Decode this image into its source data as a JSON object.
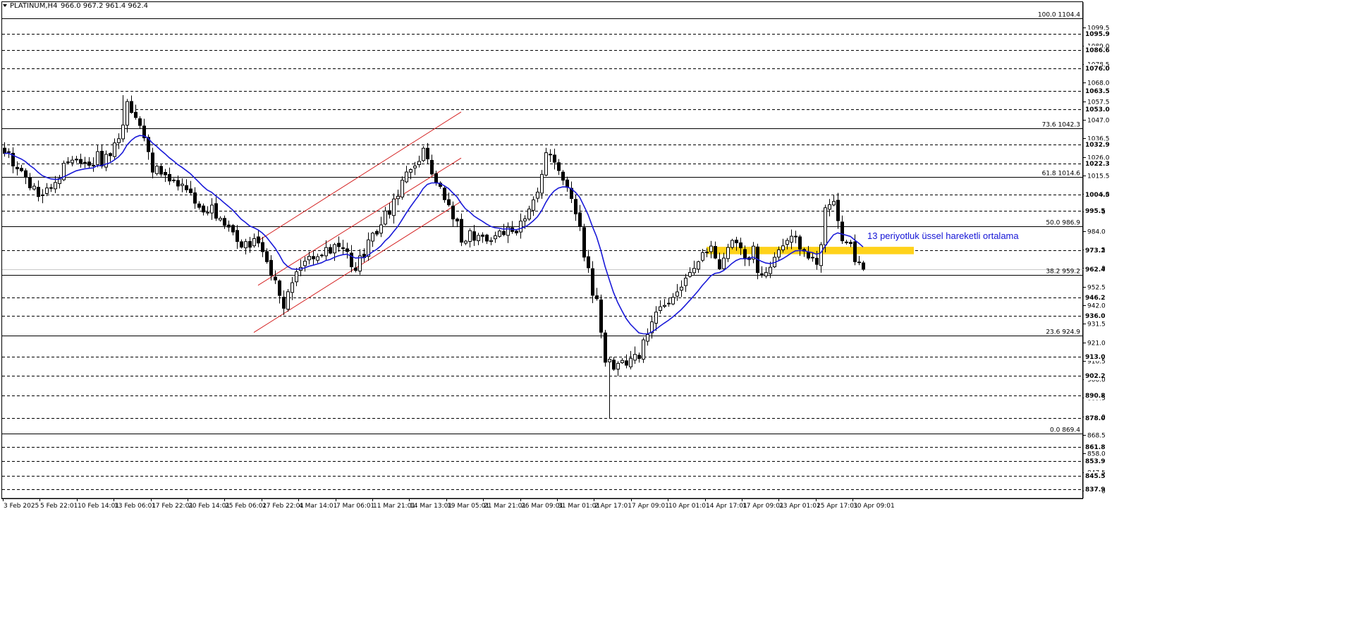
{
  "header": {
    "collapse_icon": "triangle-down-icon",
    "symbol_label": "PLATINUM,H4",
    "ohlc_text": "966.0 967.2 961.4 962.4"
  },
  "annotation": {
    "text": "13 periyotluk üssel hareketli ortalama"
  },
  "colors": {
    "candle": "#000000",
    "ema": "#1a1ad8",
    "channel": "#d42020",
    "zone": "#ffd21a",
    "grid": "#000000",
    "background": "#ffffff"
  },
  "chart_data": {
    "type": "line",
    "symbol": "PLATINUM",
    "timeframe": "H4",
    "ylim": [
      832.6,
      1113.7
    ],
    "y_ticks": [
      1099.5,
      1089.0,
      1078.5,
      1068.0,
      1057.5,
      1047.0,
      1036.5,
      1026.0,
      1015.5,
      1005.0,
      995.0,
      984.0,
      973.5,
      963.0,
      952.5,
      942.0,
      931.5,
      921.0,
      910.5,
      900.0,
      889.5,
      879.0,
      868.5,
      858.0,
      847.5,
      837.0
    ],
    "x_labels": [
      "3 Feb 2025",
      "5 Feb 22:01",
      "10 Feb 14:01",
      "13 Feb 06:01",
      "17 Feb 22:01",
      "20 Feb 14:01",
      "25 Feb 06:01",
      "27 Feb 22:01",
      "4 Mar 14:01",
      "7 Mar 06:01",
      "11 Mar 21:01",
      "14 Mar 13:01",
      "19 Mar 05:01",
      "21 Mar 21:01",
      "26 Mar 09:01",
      "31 Mar 01:01",
      "2 Apr 17:01",
      "7 Apr 09:01",
      "10 Apr 01:01",
      "14 Apr 17:01",
      "17 Apr 09:01",
      "23 Apr 01:01",
      "25 Apr 17:01",
      "30 Apr 09:01"
    ],
    "price_levels": [
      1095.9,
      1086.6,
      1076.0,
      1063.5,
      1053.0,
      1032.9,
      1022.3,
      1004.5,
      995.5,
      973.2,
      946.2,
      936.0,
      913.0,
      902.2,
      890.8,
      878.0,
      861.8,
      853.9,
      845.5,
      837.9
    ],
    "current_price": 962.4,
    "fibonacci": [
      {
        "ratio": "100.0",
        "price": 1104.4
      },
      {
        "ratio": "73.6",
        "price": 1042.3
      },
      {
        "ratio": "61.8",
        "price": 1014.6
      },
      {
        "ratio": "50.0",
        "price": 986.9
      },
      {
        "ratio": "38.2",
        "price": 959.2
      },
      {
        "ratio": "23.6",
        "price": 924.9
      },
      {
        "ratio": "0.0",
        "price": 869.4
      }
    ],
    "close_path": [
      [
        0,
        1028
      ],
      [
        3,
        1020
      ],
      [
        6,
        1010
      ],
      [
        9,
        1003
      ],
      [
        11,
        1010
      ],
      [
        14,
        1020
      ],
      [
        17,
        1025
      ],
      [
        20,
        1018
      ],
      [
        22,
        1030
      ],
      [
        23,
        1020
      ],
      [
        26,
        1033
      ],
      [
        28,
        1045
      ],
      [
        29,
        1058
      ],
      [
        31,
        1047
      ],
      [
        32,
        1046
      ],
      [
        33,
        1040
      ],
      [
        35,
        1020
      ],
      [
        37,
        1015
      ],
      [
        40,
        1012
      ],
      [
        43,
        1008
      ],
      [
        45,
        998
      ],
      [
        48,
        996
      ],
      [
        51,
        994
      ],
      [
        53,
        985
      ],
      [
        55,
        978
      ],
      [
        57,
        976
      ],
      [
        59,
        978
      ],
      [
        61,
        973
      ],
      [
        63,
        962
      ],
      [
        64,
        955
      ],
      [
        66,
        940
      ],
      [
        67,
        950
      ],
      [
        70,
        964
      ],
      [
        73,
        968
      ],
      [
        76,
        974
      ],
      [
        79,
        975
      ],
      [
        81,
        970
      ],
      [
        82,
        966
      ],
      [
        83,
        961
      ],
      [
        86,
        978
      ],
      [
        88,
        985
      ],
      [
        90,
        992
      ],
      [
        93,
        1006
      ],
      [
        95,
        1015
      ],
      [
        97,
        1022
      ],
      [
        98,
        1025
      ],
      [
        99,
        1030
      ],
      [
        100,
        1022
      ],
      [
        103,
        1010
      ],
      [
        105,
        996
      ],
      [
        107,
        988
      ],
      [
        108,
        980
      ],
      [
        110,
        983
      ],
      [
        113,
        978
      ],
      [
        115,
        982
      ],
      [
        118,
        984
      ],
      [
        121,
        981
      ],
      [
        124,
        1000
      ],
      [
        126,
        1008
      ],
      [
        128,
        1030
      ],
      [
        130,
        1025
      ],
      [
        132,
        1012
      ],
      [
        134,
        1002
      ],
      [
        136,
        990
      ],
      [
        137,
        970
      ],
      [
        139,
        950
      ],
      [
        140,
        945
      ],
      [
        141,
        930
      ],
      [
        142,
        912
      ],
      [
        144,
        905
      ],
      [
        146,
        910
      ],
      [
        148,
        912
      ],
      [
        150,
        915
      ],
      [
        152,
        928
      ],
      [
        154,
        935
      ],
      [
        156,
        942
      ],
      [
        159,
        950
      ],
      [
        162,
        962
      ],
      [
        165,
        970
      ],
      [
        167,
        974
      ],
      [
        169,
        966
      ],
      [
        171,
        978
      ],
      [
        173,
        975
      ],
      [
        175,
        970
      ],
      [
        177,
        972
      ],
      [
        178,
        963
      ],
      [
        180,
        960
      ],
      [
        182,
        968
      ],
      [
        184,
        976
      ],
      [
        186,
        980
      ],
      [
        188,
        977
      ],
      [
        190,
        970
      ],
      [
        192,
        963
      ],
      [
        193,
        975
      ],
      [
        194,
        995
      ],
      [
        196,
        998
      ],
      [
        197,
        992
      ],
      [
        198,
        982
      ],
      [
        200,
        978
      ],
      [
        201,
        968
      ],
      [
        202,
        965
      ],
      [
        203,
        962.4
      ]
    ],
    "ema_period": 13,
    "channel": {
      "upper": [
        [
          60,
          978.5
        ],
        [
          108,
          1051.5
        ]
      ],
      "lower": [
        [
          59,
          926.6
        ],
        [
          108,
          1000.8
        ]
      ],
      "middle": [
        [
          60,
          953.3
        ],
        [
          108,
          1025.4
        ]
      ]
    },
    "zone": {
      "x_from": 166,
      "x_to": 215,
      "price_low": 970.9,
      "price_high": 975.1
    }
  }
}
